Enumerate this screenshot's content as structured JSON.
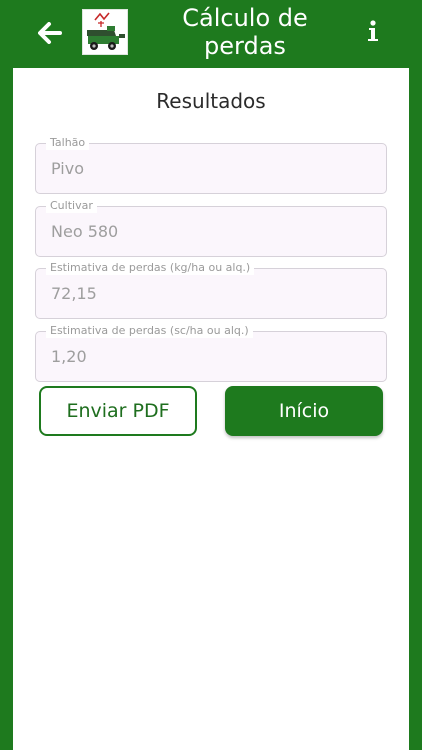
{
  "app": {
    "title": "Cálculo de perdas",
    "brand_color": "#1e7a1e",
    "back_icon": "arrow-left-icon",
    "logo_icon": "harvester-logo-icon",
    "info_icon": "info-icon"
  },
  "results": {
    "heading": "Resultados",
    "fields": [
      {
        "label": "Talhão",
        "value": "Pivo"
      },
      {
        "label": "Cultivar",
        "value": "Neo 580"
      },
      {
        "label": "Estimativa de perdas (kg/ha ou alq.)",
        "value": "72,15"
      },
      {
        "label": "Estimativa de perdas (sc/ha ou alq.)",
        "value": "1,20"
      }
    ]
  },
  "actions": {
    "send_pdf_label": "Enviar PDF",
    "home_label": "Início"
  }
}
